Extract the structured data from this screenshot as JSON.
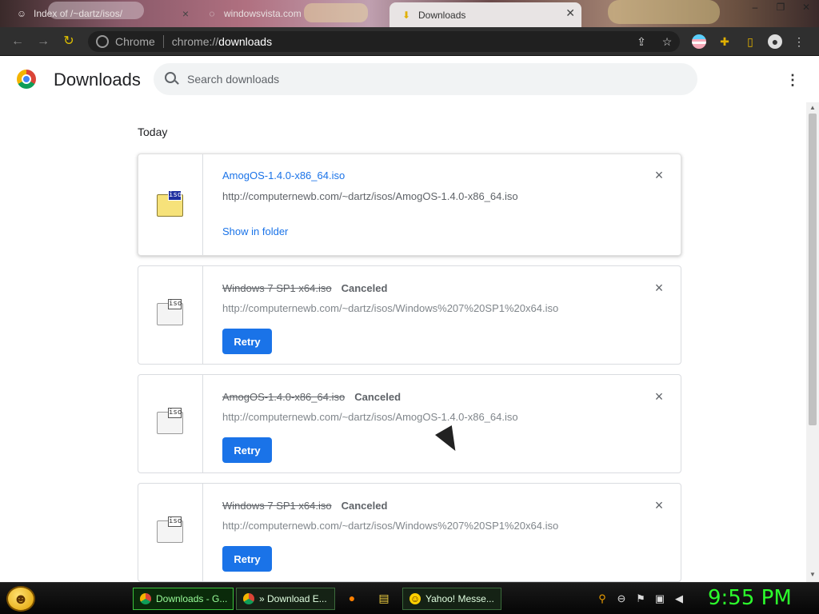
{
  "browser": {
    "tabs": [
      {
        "title": "Index of /~dartz/isos/"
      },
      {
        "title": "windowsvista.com"
      },
      {
        "title": "Downloads"
      }
    ],
    "omnibox": {
      "chip": "Chrome",
      "url_prefix": "chrome://",
      "url_host": "downloads"
    },
    "window_controls": [
      "–",
      "❐",
      "✕"
    ]
  },
  "page": {
    "title": "Downloads",
    "search_placeholder": "Search downloads",
    "section": "Today"
  },
  "downloads": [
    {
      "name": "AmogOS-1.4.0-x86_64.iso",
      "url": "http://computernewb.com/~dartz/isos/AmogOS-1.4.0-x86_64.iso",
      "action": "Show in folder",
      "status": ""
    },
    {
      "name": "Windows 7 SP1 x64.iso",
      "url": "http://computernewb.com/~dartz/isos/Windows%207%20SP1%20x64.iso",
      "action": "Retry",
      "status": "Canceled"
    },
    {
      "name": "AmogOS-1.4.0-x86_64.iso",
      "url": "http://computernewb.com/~dartz/isos/AmogOS-1.4.0-x86_64.iso",
      "action": "Retry",
      "status": "Canceled"
    },
    {
      "name": "Windows 7 SP1 x64.iso",
      "url": "http://computernewb.com/~dartz/isos/Windows%207%20SP1%20x64.iso",
      "action": "Retry",
      "status": "Canceled"
    }
  ],
  "file_icon_tag": "iso",
  "taskbar": {
    "buttons": [
      {
        "label": "Downloads - G..."
      },
      {
        "label": "» Download E..."
      },
      {
        "label": "Yahoo! Messe..."
      }
    ],
    "clock": "9:55 PM"
  },
  "colors": {
    "accent": "#1a73e8",
    "toolbar": "#2f2f2f",
    "clock": "#2cff2c"
  }
}
